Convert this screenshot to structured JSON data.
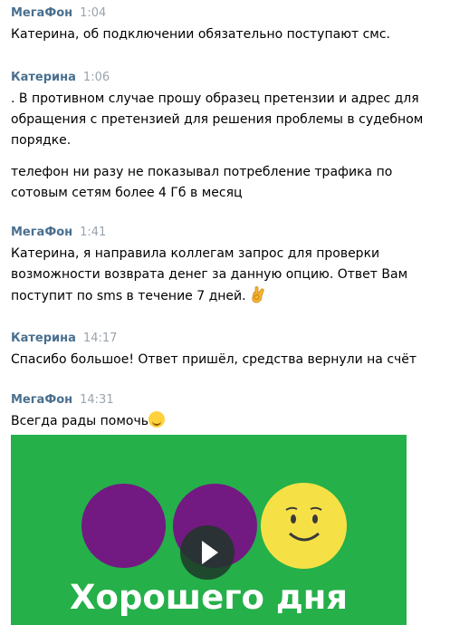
{
  "messages": [
    {
      "author": "МегаФон",
      "time": "1:04",
      "lines": [
        "Катерина, об подключении обязательно поступают смс."
      ]
    },
    {
      "author": "Катерина",
      "time": "1:06",
      "lines": [
        ". В противном случае прошу образец претензии и адрес для",
        "обращения с претензией для решения проблемы в судебном",
        "порядке.",
        "телефон ни разу не показывал потребление трафика по",
        "сотовым сетям более 4 Гб в месяц"
      ]
    },
    {
      "author": "МегаФон",
      "time": "1:41",
      "lines": [
        "Катерина, я направила коллегам запрос для проверки",
        "возможности возврата денег за данную опцию. Ответ Вам",
        "поступит по sms в течение 7 дней."
      ],
      "emoji": "ok-hand-icon"
    },
    {
      "author": "Катерина",
      "time": "14:17",
      "lines": [
        "Спасибо большое! Ответ пришёл, средства вернули на счёт"
      ]
    },
    {
      "author": "МегаФон",
      "time": "14:31",
      "lines": [
        "Всегда рады помочь"
      ],
      "emoji": "smiling-face-icon"
    }
  ],
  "video": {
    "caption": "Хорошего дня",
    "background_color": "#25b04a",
    "circle_color": "#731982",
    "sun_color": "#f5e146",
    "play_icon": "play-icon"
  }
}
